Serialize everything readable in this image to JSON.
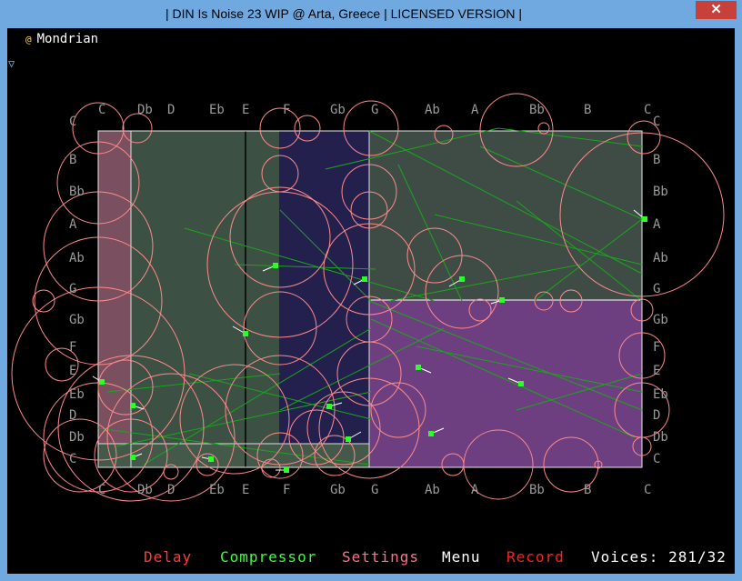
{
  "window": {
    "title": "| DIN Is Noise 23 WIP @ Arta, Greece | LICENSED VERSION |",
    "close_glyph": "✕"
  },
  "patch": {
    "at_symbol": "@",
    "name": "Mondrian",
    "menu_toggle_glyph": "▽"
  },
  "scale": {
    "top_notes": [
      "C",
      "Db",
      "D",
      "Eb",
      "E",
      "F",
      "Gb",
      "G",
      "Ab",
      "A",
      "Bb",
      "B",
      "C"
    ],
    "bottom_notes": [
      "C",
      "Db",
      "D",
      "Eb",
      "E",
      "F",
      "Gb",
      "G",
      "Ab",
      "A",
      "Bb",
      "B",
      "C"
    ],
    "left_notes": [
      "C",
      "B",
      "Bb",
      "A",
      "Ab",
      "G",
      "Gb",
      "F",
      "E",
      "Eb",
      "D",
      "Db",
      "C"
    ],
    "right_notes": [
      "C",
      "B",
      "Bb",
      "A",
      "Ab",
      "G",
      "Gb",
      "F",
      "E",
      "Eb",
      "D",
      "Db",
      "C"
    ]
  },
  "bottom_bar": {
    "delay": "Delay",
    "compressor": "Compressor",
    "settings": "Settings",
    "menu": "Menu",
    "record": "Record",
    "voices": "Voices: 281/32"
  },
  "colors": {
    "delay": "#ff3b3b",
    "compressor": "#3bff3b",
    "settings": "#ff6f8a",
    "menu": "#ffffff",
    "record": "#ff2020",
    "voices": "#ffffff",
    "circles": "#ff8a8a",
    "note_labels": "#9a9a9a",
    "drones": "#2aff2a"
  }
}
